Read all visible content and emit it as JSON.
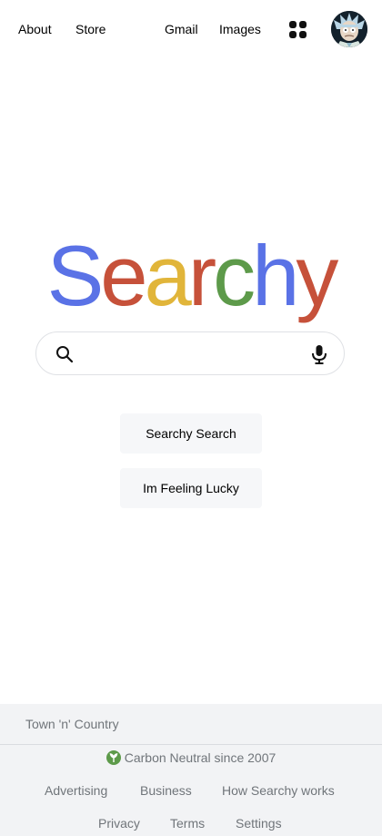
{
  "header": {
    "left_links": [
      "About",
      "Store"
    ],
    "right_links": [
      "Gmail",
      "Images"
    ],
    "apps_icon": "apps-grid-icon",
    "avatar_icon": "user-avatar-icon"
  },
  "logo": {
    "letters": [
      {
        "char": "S",
        "color": "#5a72e6"
      },
      {
        "char": "e",
        "color": "#c6513a"
      },
      {
        "char": "a",
        "color": "#e1b53a"
      },
      {
        "char": "r",
        "color": "#c6513a"
      },
      {
        "char": "c",
        "color": "#5d9a4a"
      },
      {
        "char": "h",
        "color": "#5a72e6"
      },
      {
        "char": "y",
        "color": "#c6513a"
      }
    ]
  },
  "search": {
    "placeholder": "",
    "value": "",
    "search_icon": "search-icon",
    "mic_icon": "microphone-icon"
  },
  "buttons": {
    "search_label": "Searchy Search",
    "lucky_label": "Im Feeling Lucky"
  },
  "footer": {
    "location": "Town 'n' Country",
    "carbon_text": "Carbon Neutral since 2007",
    "carbon_icon": "leaf-icon",
    "links_row1": [
      "Advertising",
      "Business",
      "How Searchy works"
    ],
    "links_row2": [
      "Privacy",
      "Terms",
      "Settings"
    ]
  },
  "colors": {
    "footer_bg": "#f2f3f5",
    "button_bg": "#f6f7f9",
    "leaf_green": "#5d9a4a"
  }
}
